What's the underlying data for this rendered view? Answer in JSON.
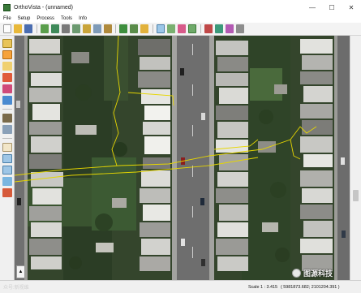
{
  "window": {
    "title": "OrthoVista - (unnamed)",
    "minimize_glyph": "—",
    "maximize_glyph": "☐",
    "close_glyph": "✕"
  },
  "menu": {
    "items": [
      "File",
      "Setup",
      "Process",
      "Tools",
      "Info"
    ]
  },
  "toolbar": {
    "icons": [
      "new-icon",
      "open-icon",
      "save-icon",
      "import-icon",
      "mosaic-icon",
      "cut-icon",
      "grid-icon",
      "edit-icon",
      "layers-icon",
      "export-icon",
      "tiles-icon",
      "folder-icon",
      "select-icon",
      "zoom-icon",
      "link-icon",
      "colour-icon",
      "tone-icon",
      "palette-icon",
      "view-icon",
      "help-icon"
    ]
  },
  "left_toolbar": {
    "icons": [
      "pointer-icon",
      "select-frame-icon",
      "seam-icon",
      "polygon-icon",
      "brush-icon",
      "layers-icon",
      "hand-icon",
      "zoom-in-icon",
      "zoom-out-icon",
      "fit-icon",
      "home-icon"
    ]
  },
  "status": {
    "scale": "Scale 1 : 3.415",
    "coordinates": "( 5981873.682; 2101204.391 )",
    "bottom_left_watermark": "众号:新视维"
  },
  "watermark": {
    "text": "图源科技"
  },
  "map": {
    "street_color": "#6b6b6b",
    "seam_line_color": "#e6d600",
    "house_roof_color": "#d8d8d4",
    "vegetation_color": "#2e4324"
  }
}
